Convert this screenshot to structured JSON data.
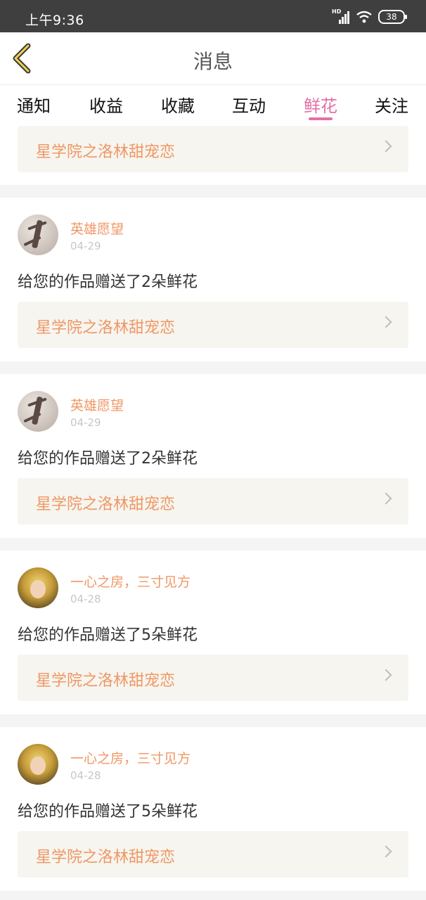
{
  "status_bar": {
    "time": "上午9:36",
    "signal_label": "HD",
    "battery": "38"
  },
  "header": {
    "title": "消息",
    "back_icon": "chevron-left-icon"
  },
  "tabs": [
    {
      "label": "通知",
      "active": false
    },
    {
      "label": "收益",
      "active": false
    },
    {
      "label": "收藏",
      "active": false
    },
    {
      "label": "互动",
      "active": false
    },
    {
      "label": "鲜花",
      "active": true
    },
    {
      "label": "关注",
      "active": false
    }
  ],
  "colors": {
    "accent": "#e46fa5",
    "highlight": "#f09765",
    "box_bg": "#f6f5ef"
  },
  "first_card": {
    "work_title": "星学院之洛林甜宠恋"
  },
  "items": [
    {
      "name": "英雄愿望",
      "date": "04-29",
      "message": "给您的作品赠送了2朵鲜花",
      "work_title": "星学院之洛林甜宠恋"
    },
    {
      "name": "英雄愿望",
      "date": "04-29",
      "message": "给您的作品赠送了2朵鲜花",
      "work_title": "星学院之洛林甜宠恋"
    },
    {
      "name": "一心之房，三寸见方",
      "date": "04-28",
      "message": "给您的作品赠送了5朵鲜花",
      "work_title": "星学院之洛林甜宠恋"
    },
    {
      "name": "一心之房，三寸见方",
      "date": "04-28",
      "message": "给您的作品赠送了5朵鲜花",
      "work_title": "星学院之洛林甜宠恋"
    }
  ]
}
